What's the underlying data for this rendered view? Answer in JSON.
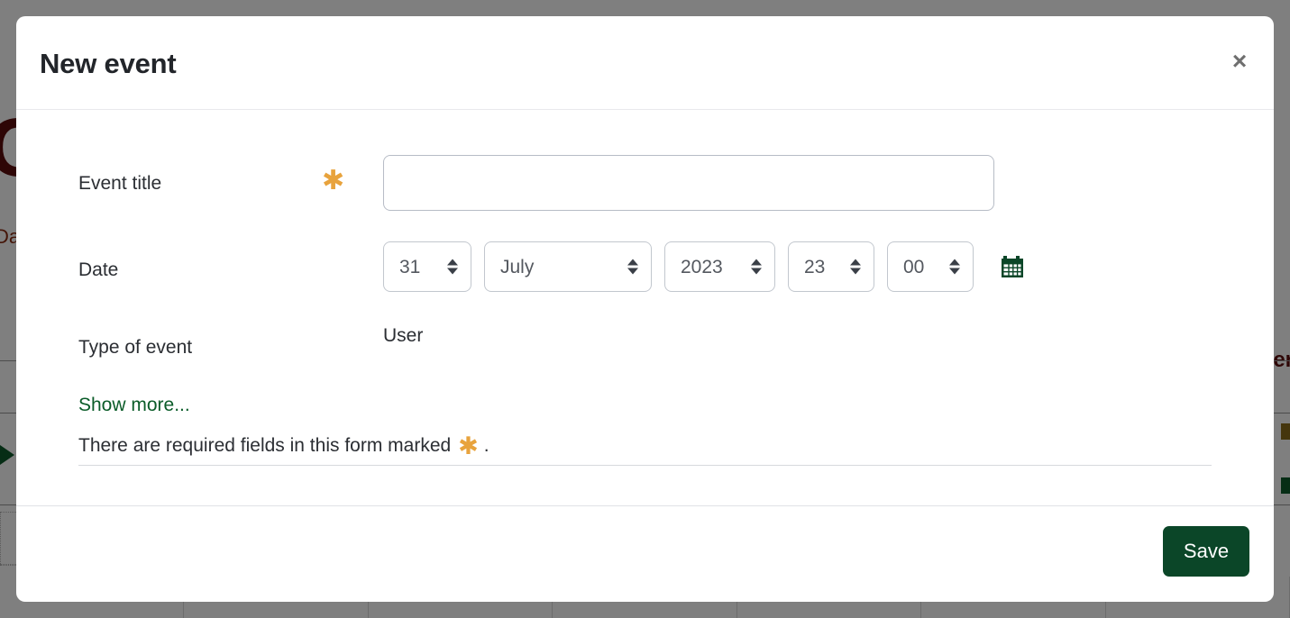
{
  "background": {
    "brand_letter": "C",
    "date_label": "Da",
    "right_text": "er"
  },
  "modal": {
    "title": "New event",
    "close_label": "×",
    "fields": {
      "event_title": {
        "label": "Event title",
        "required_marker": "✱",
        "value": "",
        "placeholder": ""
      },
      "date": {
        "label": "Date",
        "day": "31",
        "month": "July",
        "year": "2023",
        "hour": "23",
        "minute": "00",
        "calendar_icon": "calendar-icon"
      },
      "type_of_event": {
        "label": "Type of event",
        "value": "User"
      }
    },
    "show_more_label": "Show more...",
    "required_note": {
      "before": "There are required fields in this form marked",
      "marker": "✱",
      "after": "."
    },
    "footer": {
      "save_label": "Save"
    }
  },
  "colors": {
    "accent_green": "#0b4628",
    "link_green": "#0b5c29",
    "required_orange": "#e8a33d",
    "title_text": "#22252a",
    "overlay": "rgba(0,0,0,0.5)"
  }
}
